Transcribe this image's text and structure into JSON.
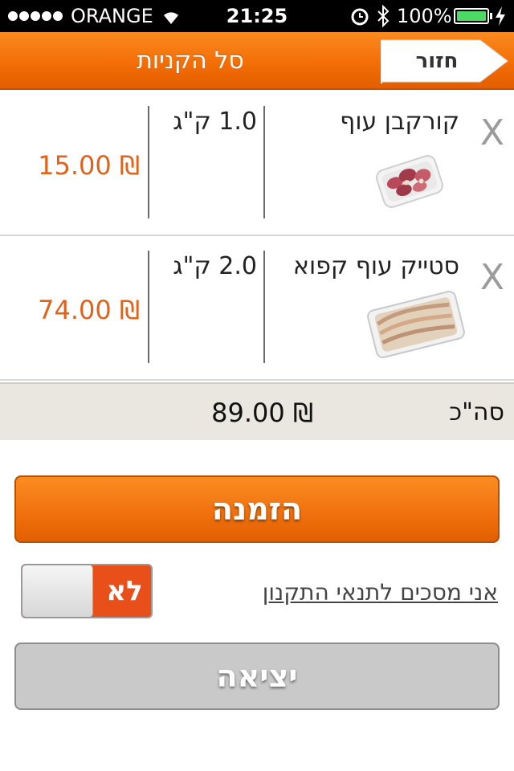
{
  "status_bar": {
    "carrier": "ORANGE",
    "time": "21:25",
    "battery": "100%",
    "battery_level": 1.0
  },
  "nav": {
    "title": "סל הקניות",
    "back_label": "חזור"
  },
  "cart": {
    "items": [
      {
        "name": "קורקבן עוף",
        "quantity": "1.0 ק\"ג",
        "price": "15.00 ₪",
        "remove": "X",
        "image": "gizzards-tray-icon"
      },
      {
        "name": "סטייק עוף קפוא",
        "quantity": "2.0 ק\"ג",
        "price": "74.00 ₪",
        "remove": "X",
        "image": "frozen-steak-tray-icon"
      }
    ],
    "total_label": "סה\"כ",
    "total_value": "89.00 ₪"
  },
  "actions": {
    "order_label": "הזמנה",
    "terms_link": "אני מסכים לתנאי התקנון",
    "terms_toggle_label": "לא",
    "terms_agreed": false,
    "exit_label": "יציאה"
  },
  "colors": {
    "accent": "#f26c05",
    "price": "#e2621a",
    "toggle_off": "#e84f19",
    "disabled_button": "#c9c9c9"
  }
}
